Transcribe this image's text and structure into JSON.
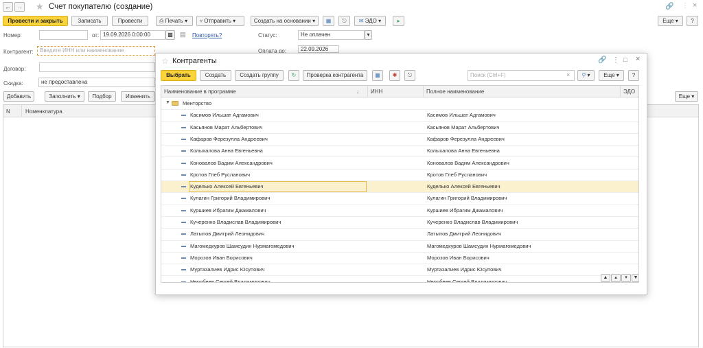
{
  "window": {
    "title": "Счет покупателю (создание)",
    "more_label": "Еще"
  },
  "toolbar": {
    "post_close": "Провести и закрыть",
    "save": "Записать",
    "post": "Провести",
    "print": "Печать",
    "send": "Отправить",
    "create_based": "Создать на основании",
    "edo": "ЭДО",
    "more": "Еще"
  },
  "form": {
    "number_label": "Номер:",
    "number_value": "",
    "date_from_label": "от:",
    "date_value": "19.09.2026  0:00:00",
    "repeat_link": "Повторять?",
    "status_label": "Статус:",
    "status_value": "Не оплачен",
    "counterparty_label": "Контрагент:",
    "counterparty_placeholder": "Введите ИНН или наименование",
    "pay_until_label": "Оплата до:",
    "pay_until_value": "22.09.2026",
    "contract_label": "Договор:",
    "discount_label": "Скидка:",
    "discount_value": "не предоставлена"
  },
  "table_toolbar": {
    "add": "Добавить",
    "fill": "Заполнить",
    "pick": "Подбор",
    "change": "Изменить",
    "more": "Еще"
  },
  "table": {
    "col_n": "N",
    "col_nomenclature": "Номенклатура"
  },
  "modal": {
    "title": "Контрагенты",
    "select": "Выбрать",
    "create": "Создать",
    "create_group": "Создать группу",
    "check": "Проверка контрагента",
    "search_placeholder": "Поиск (Ctrl+F)",
    "more": "Еще",
    "help": "?",
    "columns": {
      "name": "Наименование в программе",
      "inn": "ИНН",
      "full_name": "Полное наименование",
      "edo": "ЭДО"
    },
    "group": "Менторство",
    "rows": [
      {
        "name": "Касимов Ильшат Адгамович",
        "full": "Касимов Ильшат Адгамович"
      },
      {
        "name": "Касьянов Марат Альбертович",
        "full": "Касьянов Марат Альбертович"
      },
      {
        "name": "Кафаров Ферезулла Андреевич",
        "full": "Кафаров Ферезулла Андреевич"
      },
      {
        "name": "Колыхалова Анна Евгеньевна",
        "full": "Колыхалова Анна Евгеньевна"
      },
      {
        "name": "Коновалов Вадим Александрович",
        "full": "Коновалов Вадим Александрович"
      },
      {
        "name": "Кротов Глеб Русланович",
        "full": "Кротов Глеб Русланович"
      },
      {
        "name": "Куделько Алексей Евгеньевич",
        "full": "Куделько Алексей Евгеньевич"
      },
      {
        "name": "Кулагин Григорий Владимирович",
        "full": "Кулагин Григорий Владимирович"
      },
      {
        "name": "Куршиев Ибрагим Джамалович",
        "full": "Куршиев Ибрагим Джамалович"
      },
      {
        "name": "Кучеренко Владислав Владимирович",
        "full": "Кучеренко Владислав Владимирович"
      },
      {
        "name": "Латыпов Дмитрий Леонидович",
        "full": "Латыпов Дмитрий Леонидович"
      },
      {
        "name": "Магомедкуров Шамсудин Нурмагомедович",
        "full": "Магомедкуров Шамсудин Нурмагомедович"
      },
      {
        "name": "Морозов Иван Борисович",
        "full": "Морозов Иван Борисович"
      },
      {
        "name": "Муртазалиев Идрис Юсупович",
        "full": "Муртазалиев Идрис Юсупович"
      },
      {
        "name": "Неробеев Сергей Владимирович",
        "full": "Неробеев Сергей Владимирович"
      }
    ],
    "selected_index": 6
  }
}
